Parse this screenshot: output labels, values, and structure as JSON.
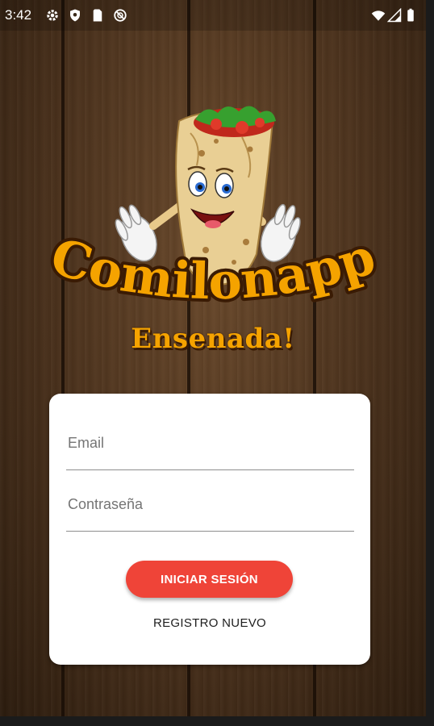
{
  "status_bar": {
    "time": "3:42",
    "left_icons": [
      "settings-icon",
      "shield-icon",
      "sim-card-icon",
      "no-disturb-icon"
    ],
    "right_icons": [
      "wifi-icon",
      "signal-icon",
      "battery-icon"
    ]
  },
  "logo": {
    "title": "Comilonapp",
    "subtitle": "Ensenada!",
    "mascot": "burrito-mascot-icon",
    "colors": {
      "title": "#f5a300",
      "outline": "#3a1b04"
    }
  },
  "login_form": {
    "email_placeholder": "Email",
    "password_placeholder": "Contraseña",
    "login_button": "INICIAR SESIÓN",
    "register_link": "REGISTRO NUEVO"
  },
  "colors": {
    "accent": "#ef4438",
    "card": "#ffffff",
    "wood": "#4a311c"
  }
}
